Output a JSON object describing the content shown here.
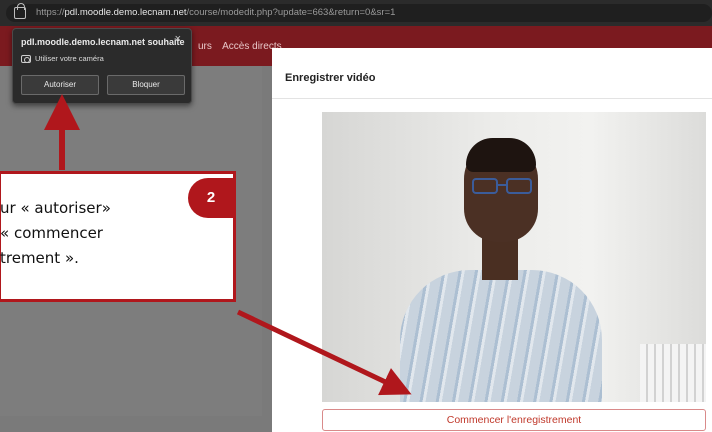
{
  "browser": {
    "url_prefix": "https://",
    "url_domain": "pdl.moodle.demo.lecnam.net",
    "url_path": "/course/modedit.php?update=663&return=0&sr=1"
  },
  "navbar": {
    "links": [
      "urs",
      "Accès directs"
    ]
  },
  "permission_popup": {
    "title": "pdl.moodle.demo.lecnam.net souhaite",
    "close": "×",
    "camera_label": "Utiliser votre caméra",
    "allow_label": "Autoriser",
    "block_label": "Bloquer"
  },
  "modal": {
    "title": "Enregistrer vidéo",
    "start_button": "Commencer l'enregistrement"
  },
  "callout": {
    "text": "ur « autoriser»\n« commencer\ntrement ».",
    "step_number": "2"
  },
  "colors": {
    "accent": "#b0171c",
    "navbar": "#7b1a1f"
  }
}
